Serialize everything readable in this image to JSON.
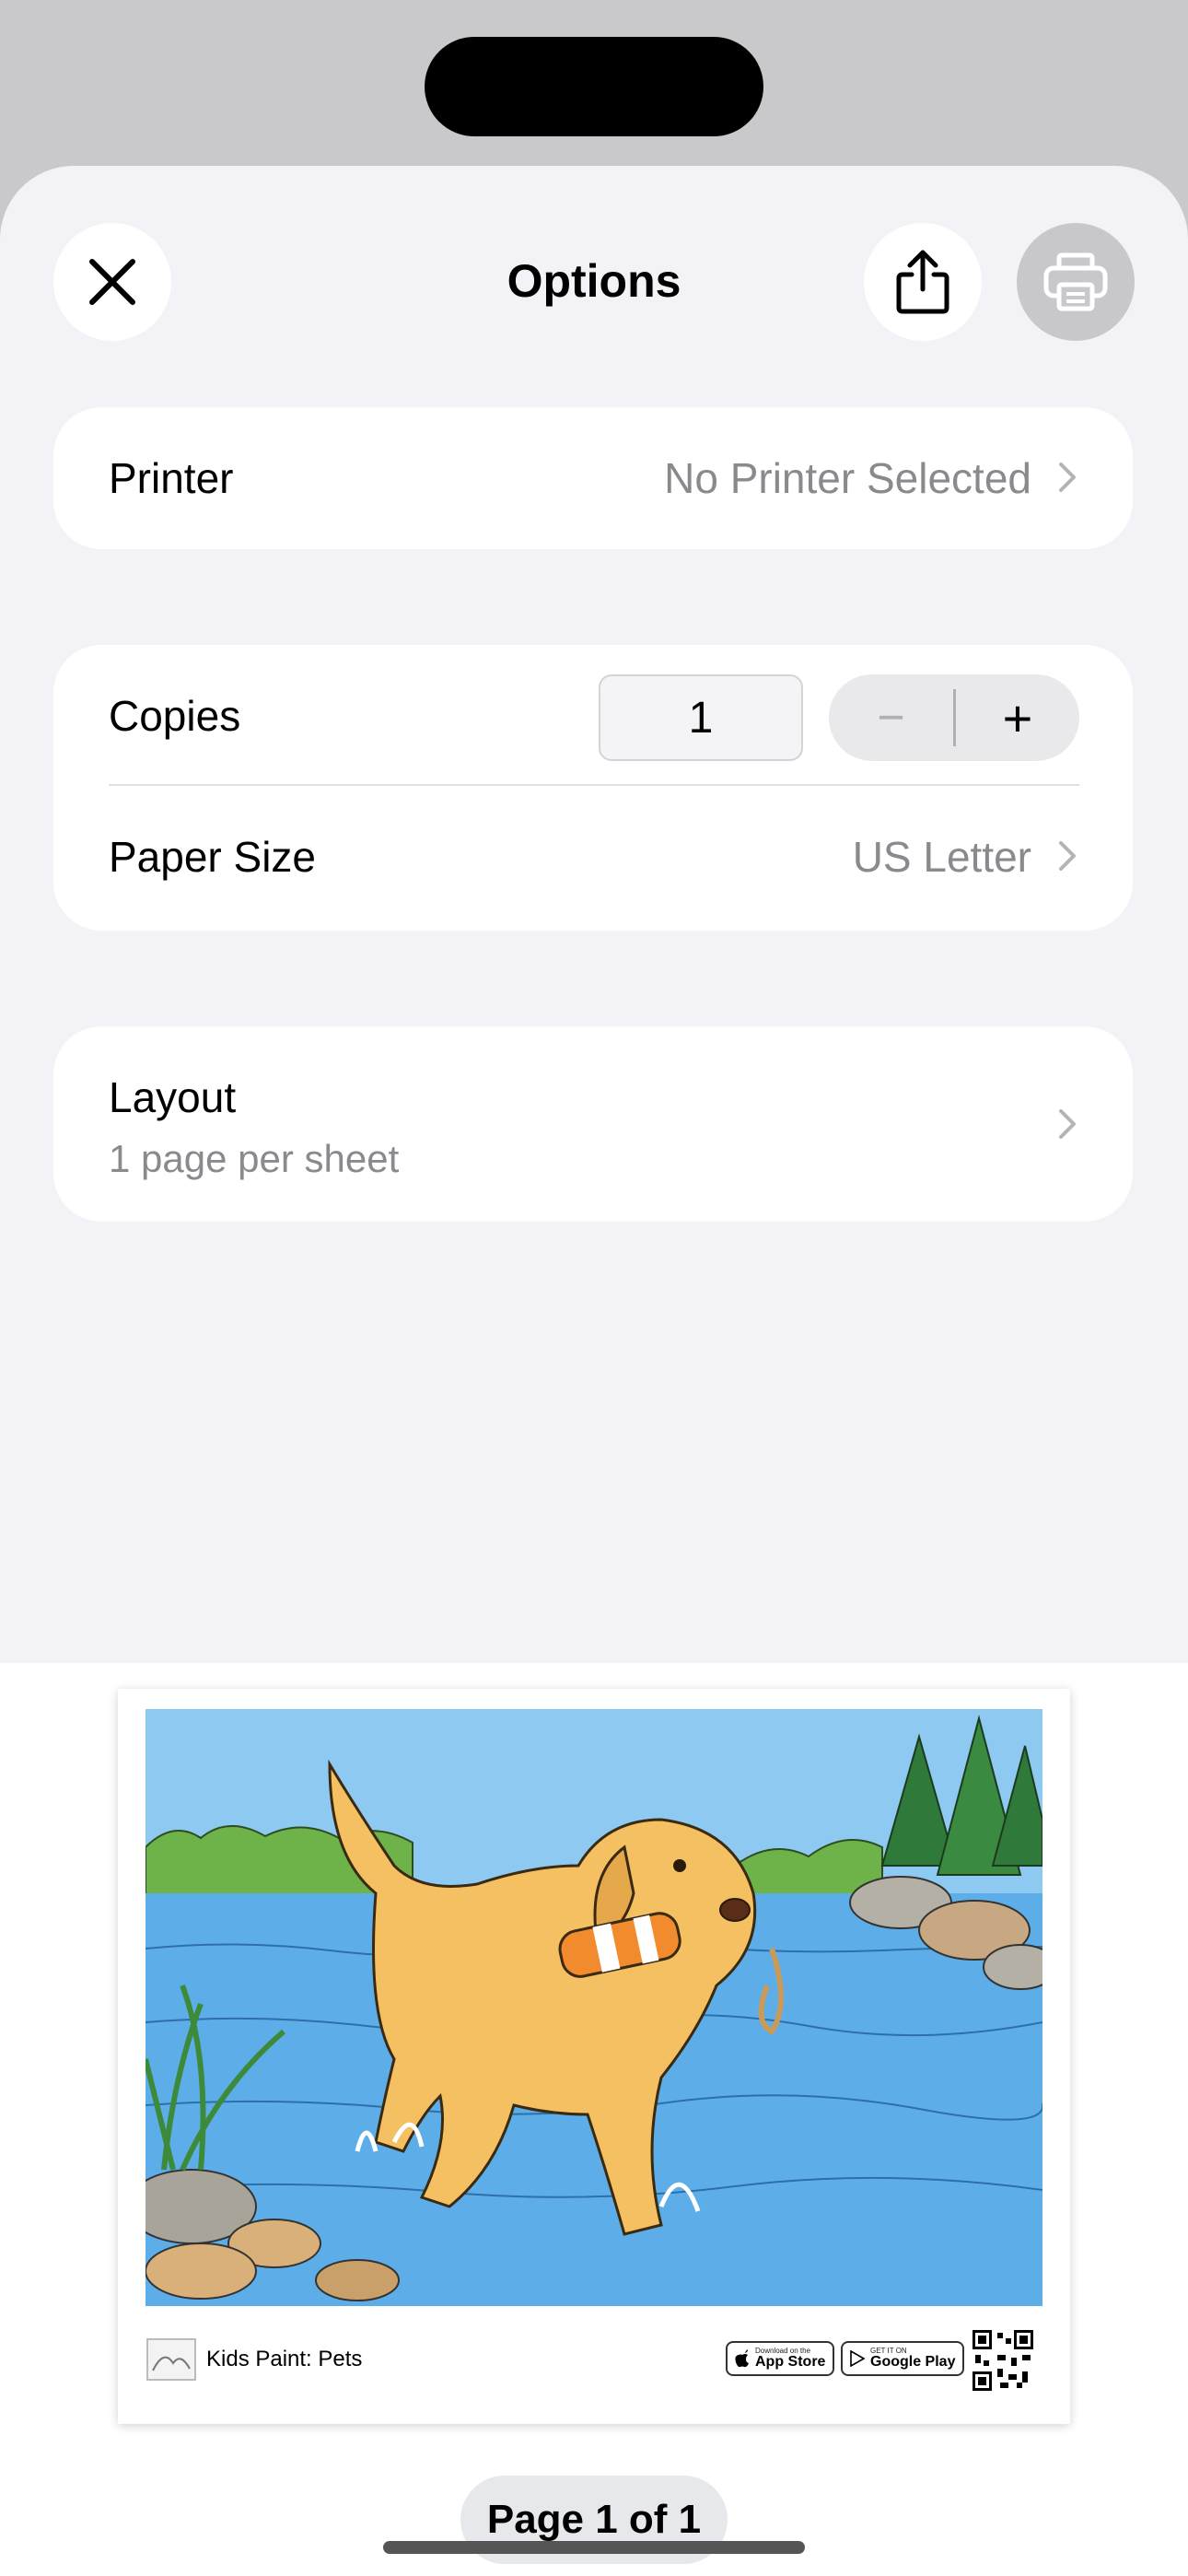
{
  "header": {
    "title": "Options"
  },
  "printer_row": {
    "label": "Printer",
    "value": "No Printer Selected"
  },
  "copies_row": {
    "label": "Copies",
    "value": "1",
    "decrement_symbol": "−",
    "increment_symbol": "+"
  },
  "paper_row": {
    "label": "Paper Size",
    "value": "US Letter"
  },
  "layout_row": {
    "label": "Layout",
    "value": "1 page per sheet"
  },
  "preview": {
    "footer_app_name": "Kids Paint: Pets",
    "app_store_small": "Download on the",
    "app_store_big": "App Store",
    "google_small": "GET IT ON",
    "google_big": "Google Play",
    "page_indicator": "Page 1 of 1"
  },
  "icons": {
    "close": "close-icon",
    "share": "share-icon",
    "print": "printer-icon",
    "chevron": "chevron-right-icon"
  },
  "colors": {
    "sheet_bg": "#f2f2f7",
    "secondary_text": "#8a8a8e",
    "print_button_disabled": "#c8c8cc"
  }
}
